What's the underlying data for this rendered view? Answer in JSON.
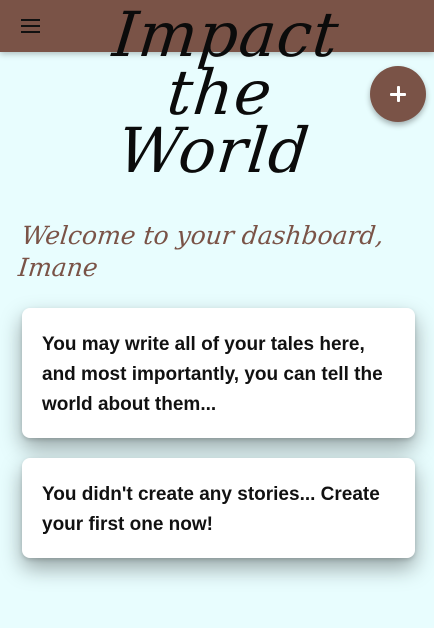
{
  "appbar": {
    "menu_icon": "hamburger-menu-icon",
    "color": "#7a5347"
  },
  "brand": {
    "line1": "Impact",
    "line2": "the",
    "line3": "World"
  },
  "fab": {
    "icon": "plus-icon",
    "label": "+"
  },
  "welcome": {
    "line1": "Welcome to your dashboard,",
    "line2": "Imane"
  },
  "cards": [
    {
      "text": "You may write all of your tales here, and most importantly, you can tell the world about them..."
    },
    {
      "text": "You didn't create any stories... Create your first one now!"
    }
  ],
  "colors": {
    "background": "#e8fdfe",
    "accent": "#7a5347",
    "card": "#ffffff"
  }
}
